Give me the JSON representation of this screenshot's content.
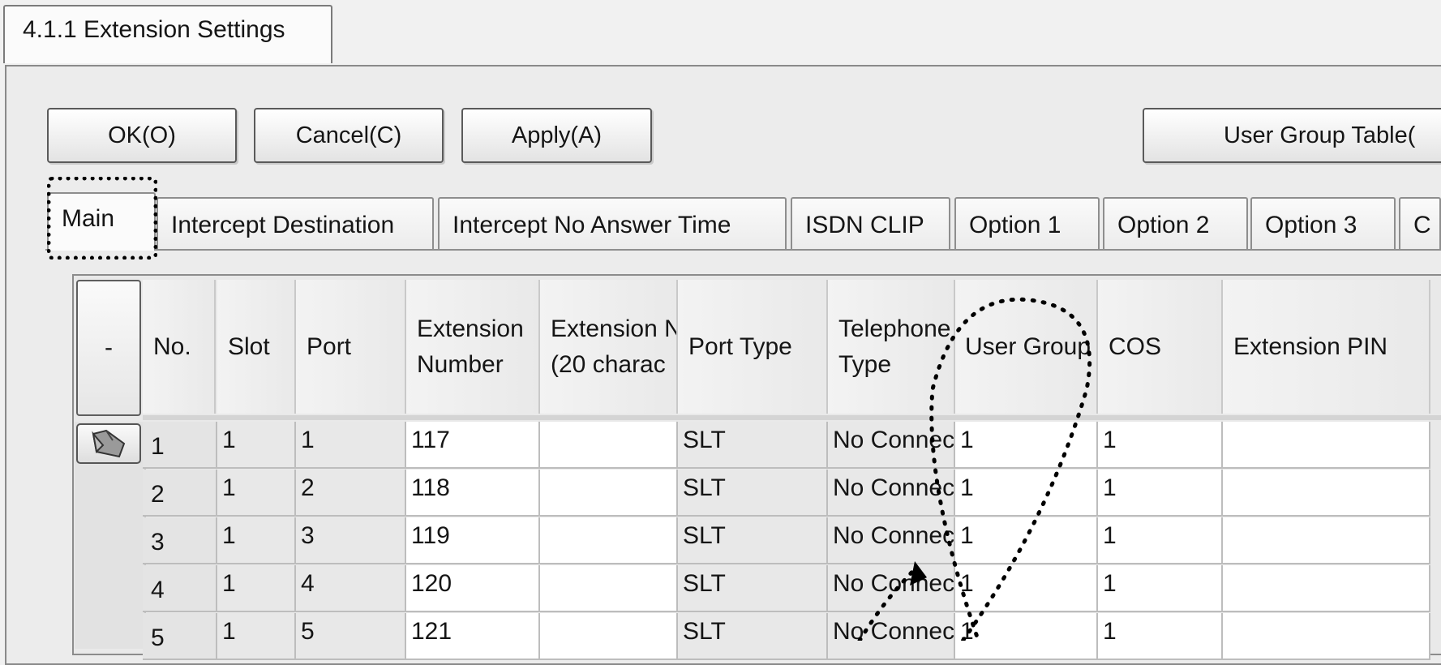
{
  "window": {
    "tab_title": "4.1.1 Extension Settings"
  },
  "buttons": {
    "ok": "OK(O)",
    "cancel": "Cancel(C)",
    "apply": "Apply(A)",
    "user_group_table": "User Group Table("
  },
  "tabs": [
    {
      "label": "Main",
      "active": true
    },
    {
      "label": "Intercept Destination"
    },
    {
      "label": "Intercept No Answer Time"
    },
    {
      "label": "ISDN CLIP"
    },
    {
      "label": "Option 1"
    },
    {
      "label": "Option 2"
    },
    {
      "label": "Option 3"
    },
    {
      "label": "C"
    }
  ],
  "grid": {
    "corner_label": "-",
    "headers": {
      "no": "No.",
      "slot": "Slot",
      "port": "Port",
      "ext_num_1": "Extension",
      "ext_num_2": "Number",
      "ext_name_1": "Extension N",
      "ext_name_2": "(20 charac",
      "port_type": "Port Type",
      "tel_type_1": "Telephone",
      "tel_type_2": "Type",
      "user_group": "User Group",
      "cos": "COS",
      "pin": "Extension PIN"
    },
    "rows": [
      {
        "no": "1",
        "slot": "1",
        "port": "1",
        "ext": "117",
        "name": "",
        "port_type": "SLT",
        "tel_type": "No Connect",
        "user_group": "1",
        "cos": "1",
        "pin": ""
      },
      {
        "no": "2",
        "slot": "1",
        "port": "2",
        "ext": "118",
        "name": "",
        "port_type": "SLT",
        "tel_type": "No Connect",
        "user_group": "1",
        "cos": "1",
        "pin": ""
      },
      {
        "no": "3",
        "slot": "1",
        "port": "3",
        "ext": "119",
        "name": "",
        "port_type": "SLT",
        "tel_type": "No Connect",
        "user_group": "1",
        "cos": "1",
        "pin": ""
      },
      {
        "no": "4",
        "slot": "1",
        "port": "4",
        "ext": "120",
        "name": "",
        "port_type": "SLT",
        "tel_type": "No Connect",
        "user_group": "1",
        "cos": "1",
        "pin": ""
      },
      {
        "no": "5",
        "slot": "1",
        "port": "5",
        "ext": "121",
        "name": "",
        "port_type": "SLT",
        "tel_type": "No Connect",
        "user_group": "1",
        "cos": "1",
        "pin": ""
      }
    ]
  }
}
